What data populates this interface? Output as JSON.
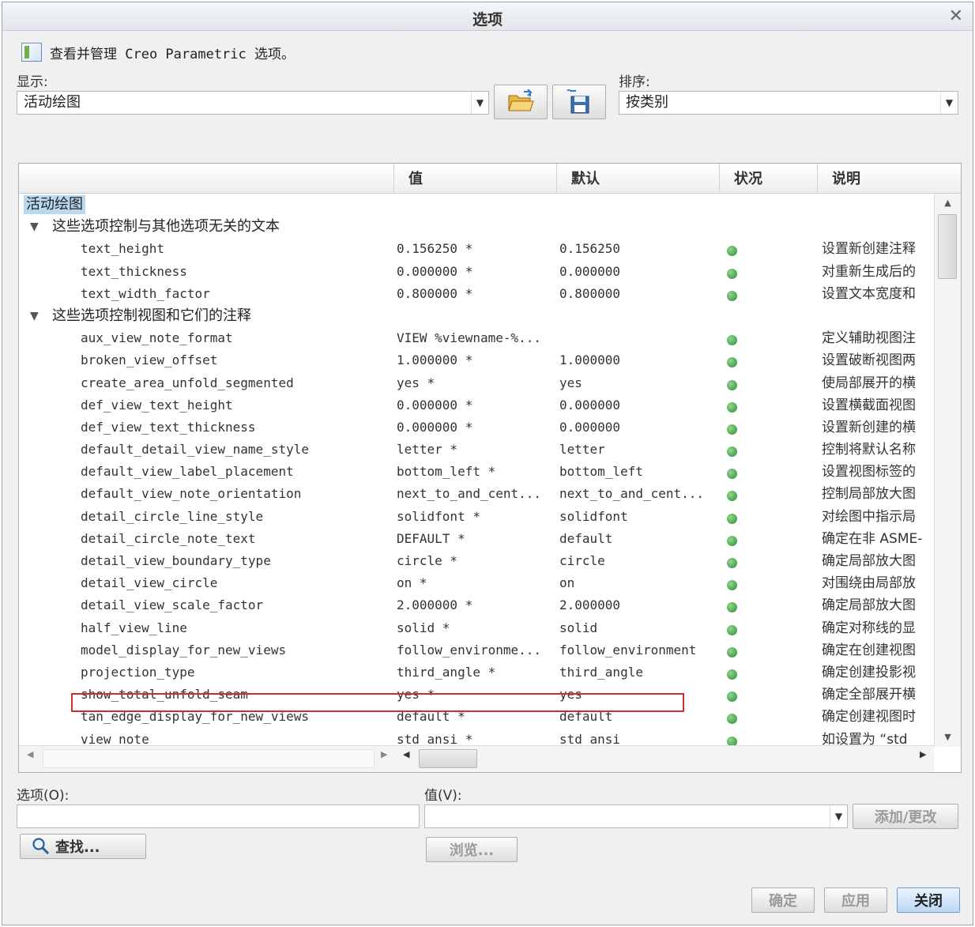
{
  "window": {
    "title": "选项"
  },
  "intro": {
    "text": "查看并管理 Creo Parametric 选项。"
  },
  "display": {
    "label": "显示:",
    "value": "活动绘图"
  },
  "sort": {
    "label": "排序:",
    "value": "按类别"
  },
  "table": {
    "headers": {
      "value": "值",
      "default": "默认",
      "status": "状况",
      "description": "说明"
    },
    "category": "活动绘图",
    "groups": [
      {
        "title": "这些选项控制与其他选项无关的文本"
      },
      {
        "title": "这些选项控制视图和它们的注释"
      }
    ],
    "rows": [
      {
        "name": "text_height",
        "value": "0.156250 *",
        "default": "0.156250",
        "desc": "设置新创建注释"
      },
      {
        "name": "text_thickness",
        "value": "0.000000 *",
        "default": "0.000000",
        "desc": "对重新生成后的"
      },
      {
        "name": "text_width_factor",
        "value": "0.800000 *",
        "default": "0.800000",
        "desc": "设置文本宽度和"
      },
      {
        "name": "aux_view_note_format",
        "value": "VIEW %viewname-%...",
        "default": "",
        "desc": "定义辅助视图注"
      },
      {
        "name": "broken_view_offset",
        "value": "1.000000 *",
        "default": "1.000000",
        "desc": "设置破断视图两"
      },
      {
        "name": "create_area_unfold_segmented",
        "value": "yes *",
        "default": "yes",
        "desc": "使局部展开的横"
      },
      {
        "name": "def_view_text_height",
        "value": "0.000000 *",
        "default": "0.000000",
        "desc": "设置横截面视图"
      },
      {
        "name": "def_view_text_thickness",
        "value": "0.000000 *",
        "default": "0.000000",
        "desc": "设置新创建的横"
      },
      {
        "name": "default_detail_view_name_style",
        "value": "letter *",
        "default": "letter",
        "desc": "控制将默认名称"
      },
      {
        "name": "default_view_label_placement",
        "value": "bottom_left *",
        "default": "bottom_left",
        "desc": "设置视图标签的"
      },
      {
        "name": "default_view_note_orientation",
        "value": "next_to_and_cent...",
        "default": "next_to_and_cent...",
        "desc": "控制局部放大图"
      },
      {
        "name": "detail_circle_line_style",
        "value": "solidfont *",
        "default": "solidfont",
        "desc": "对绘图中指示局"
      },
      {
        "name": "detail_circle_note_text",
        "value": "DEFAULT *",
        "default": "default",
        "desc": "确定在非 ASME-"
      },
      {
        "name": "detail_view_boundary_type",
        "value": "circle *",
        "default": "circle",
        "desc": "确定局部放大图"
      },
      {
        "name": "detail_view_circle",
        "value": "on *",
        "default": "on",
        "desc": "对围绕由局部放"
      },
      {
        "name": "detail_view_scale_factor",
        "value": "2.000000 *",
        "default": "2.000000",
        "desc": "确定局部放大图"
      },
      {
        "name": "half_view_line",
        "value": "solid *",
        "default": "solid",
        "desc": "确定对称线的显"
      },
      {
        "name": "model_display_for_new_views",
        "value": "follow_environme...",
        "default": "follow_environment",
        "desc": "确定在创建视图"
      },
      {
        "name": "projection_type",
        "value": "third_angle *",
        "default": "third_angle",
        "desc": "确定创建投影视"
      },
      {
        "name": "show_total_unfold_seam",
        "value": "yes *",
        "default": "yes",
        "desc": "确定全部展开横"
      },
      {
        "name": "tan_edge_display_for_new_views",
        "value": "default *",
        "default": "default",
        "desc": "确定创建视图时"
      },
      {
        "name": "view_note",
        "value": "std_ansi *",
        "default": "std_ansi",
        "desc": "如设置为 “std_"
      }
    ]
  },
  "option_field": {
    "label": "选项(O):",
    "value": ""
  },
  "value_field": {
    "label": "值(V):",
    "value": ""
  },
  "buttons": {
    "add_change": "添加/更改",
    "find": "查找...",
    "browse": "浏览...",
    "ok": "确定",
    "apply": "应用",
    "close": "关闭"
  },
  "colors": {
    "highlight_border": "#c8322d",
    "status_dot": "#2e8b3a",
    "category_highlight": "#b9d9f1"
  }
}
